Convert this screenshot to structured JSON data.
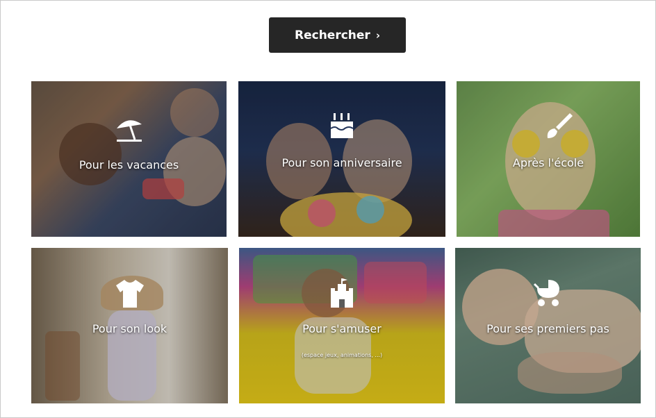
{
  "search": {
    "label": "Rechercher",
    "chevron": "›"
  },
  "cards": [
    {
      "label": "Pour les vacances",
      "icon": "beach-umbrella-icon"
    },
    {
      "label": "Pour son anniversaire",
      "icon": "birthday-cake-icon"
    },
    {
      "label": "Après l'école",
      "icon": "paintbrush-icon"
    },
    {
      "label": "Pour son look",
      "icon": "tshirt-icon"
    },
    {
      "label": "Pour s'amuser",
      "sublabel": "(espace jeux, animations, ...)",
      "icon": "castle-icon"
    },
    {
      "label": "Pour ses premiers pas",
      "icon": "stroller-icon"
    }
  ],
  "colors": {
    "button_bg": "#262626",
    "text": "#ffffff"
  }
}
